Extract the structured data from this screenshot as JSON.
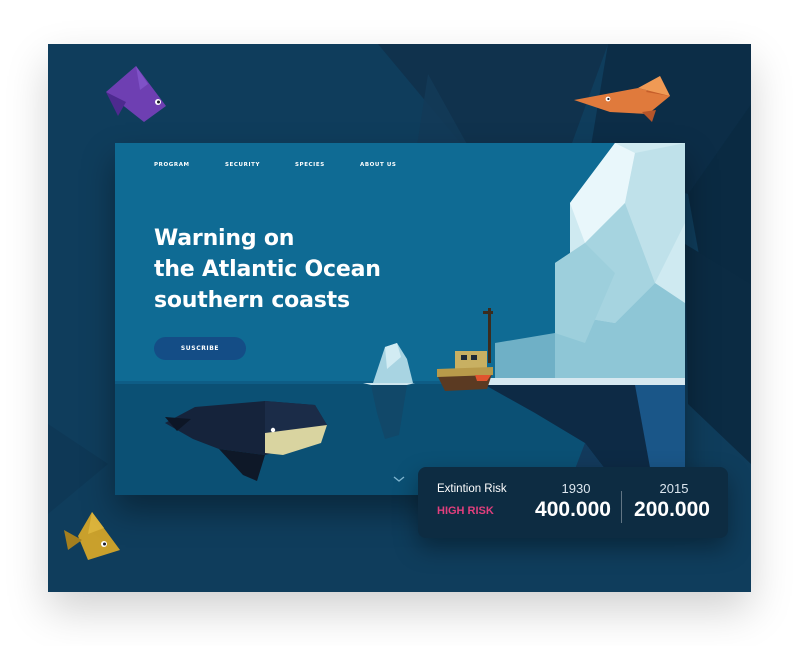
{
  "nav": {
    "items": [
      {
        "label": "PROGRAM"
      },
      {
        "label": "SECURITY"
      },
      {
        "label": "SPECIES"
      },
      {
        "label": "ABOUT US"
      }
    ]
  },
  "hero": {
    "headline_lines": [
      "Warning on",
      "the Atlantic Ocean",
      "southern coasts"
    ],
    "button_label": "SUSCRIBE"
  },
  "risk_panel": {
    "label": "Extintion Risk",
    "level": "HIGH RISK",
    "columns": [
      {
        "year": "1930",
        "count": "400.000"
      },
      {
        "year": "2015",
        "count": "200.000"
      }
    ]
  },
  "colors": {
    "frame_bg": "#0f3d5c",
    "card_bg": "#0f6b94",
    "button_bg": "#144d86",
    "risk_bg": "#0d2c42",
    "high_risk": "#e23f7d"
  },
  "icons": [
    "purple-fish-icon",
    "orange-fish-icon",
    "yellow-fish-icon",
    "whale-icon",
    "boat-icon",
    "iceberg-icon",
    "chevron-down-icon"
  ]
}
